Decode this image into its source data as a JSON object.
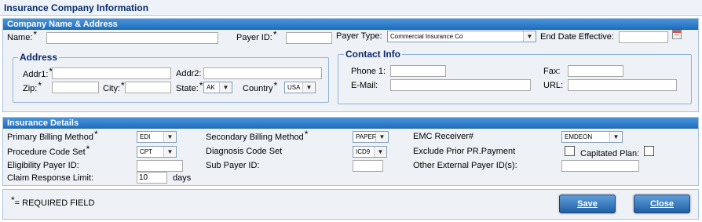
{
  "page_title": "Insurance Company Information",
  "company_section": {
    "header": "Company Name & Address",
    "name_label": "Name:",
    "name_value": "",
    "payer_id_label": "Payer ID:",
    "payer_id_value": "",
    "payer_type_label": "Payer Type:",
    "payer_type_value": "Commercial Insurance Co",
    "end_date_label": "End Date Effective:",
    "end_date_value": "",
    "address": {
      "legend": "Address",
      "addr1_label": "Addr1:",
      "addr1_value": "",
      "addr2_label": "Addr2:",
      "addr2_value": "",
      "zip_label": "Zip:",
      "zip_value": "",
      "city_label": "City:",
      "city_value": "",
      "state_label": "State:",
      "state_value": "AK",
      "country_label": "Country",
      "country_value": "USA"
    },
    "contact": {
      "legend": "Contact Info",
      "phone_label": "Phone 1:",
      "phone_value": "",
      "fax_label": "Fax:",
      "fax_value": "",
      "email_label": "E-Mail:",
      "email_value": "",
      "url_label": "URL:",
      "url_value": ""
    }
  },
  "details_section": {
    "header": "Insurance Details",
    "primary_billing_label": "Primary Billing Method",
    "primary_billing_value": "EDI",
    "secondary_billing_label": "Secondary Billing Method",
    "secondary_billing_value": "PAPER",
    "emc_receiver_label": "EMC Receiver#",
    "emc_receiver_value": "EMDEON",
    "procedure_code_label": "Procedure Code Set",
    "procedure_code_value": "CPT",
    "diagnosis_code_label": "Diagnosis Code Set",
    "diagnosis_code_value": "ICD9",
    "exclude_prior_label": "Exclude Prior PR.Payment",
    "capitated_label": "Capitated Plan:",
    "eligibility_label": "Eligibility Payer ID:",
    "eligibility_value": "",
    "sub_payer_label": "Sub Payer ID:",
    "sub_payer_value": "",
    "other_external_label": "Other External Payer ID(s):",
    "other_external_value": "",
    "claim_response_label": "Claim Response Limit:",
    "claim_response_value": "10",
    "claim_response_unit": "days"
  },
  "footer": {
    "required_star": "*",
    "required_text": "= REQUIRED FIELD",
    "save_label": "Save",
    "close_label": "Close"
  },
  "required_marker": "*",
  "dropdown_arrow": "▼"
}
